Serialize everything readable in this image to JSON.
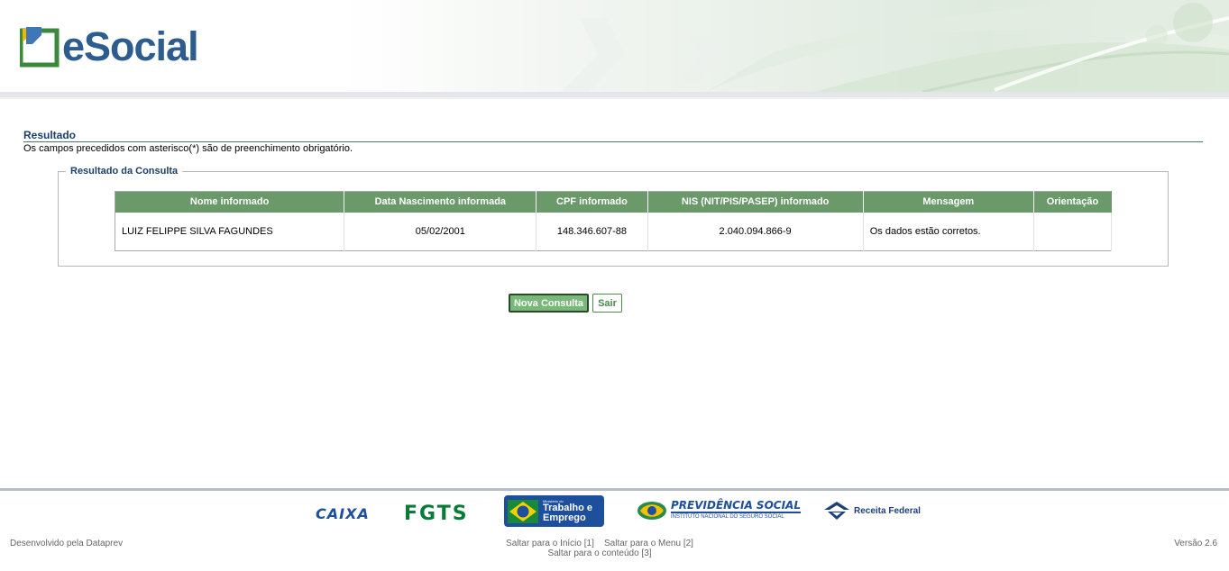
{
  "header": {
    "logo_text": "eSocial"
  },
  "page": {
    "section_title": "Resultado",
    "required_note": "Os campos precedidos com asterisco(*) são de preenchimento obrigatório."
  },
  "result": {
    "legend": "Resultado da Consulta",
    "columns": [
      "Nome informado",
      "Data Nascimento informada",
      "CPF informado",
      "NIS (NIT/PIS/PASEP) informado",
      "Mensagem",
      "Orientação"
    ],
    "rows": [
      {
        "nome": "LUIZ FELIPPE SILVA FAGUNDES",
        "data_nascimento": "05/02/2001",
        "cpf": "148.346.607-88",
        "nis": "2.040.094.866-9",
        "mensagem": "Os dados estão corretos.",
        "orientacao": ""
      }
    ]
  },
  "actions": {
    "new_query": "Nova Consulta",
    "exit": "Sair"
  },
  "partners": {
    "caixa": "CAIXA",
    "fgts": "FGTS",
    "mte_small": "Ministério do",
    "mte_big_1": "Trabalho e",
    "mte_big_2": "Emprego",
    "previdencia_title": "PREVIDÊNCIA SOCIAL",
    "previdencia_sub": "INSTITUTO NACIONAL DO SEGURO SOCIAL",
    "receita": "Receita Federal"
  },
  "footer": {
    "developed_by": "Desenvolvido pela Dataprev",
    "skip_start": "Saltar para o Início [1]",
    "skip_menu": "Saltar para o Menu [2]",
    "skip_content": "Saltar para o conteúdo [3]",
    "version": "Versão 2.6"
  },
  "colors": {
    "header_green": "#6a9a6a",
    "title_blue": "#1a3f6b",
    "logo_blue": "#2d5d8f",
    "button_green": "#7ab87a"
  }
}
